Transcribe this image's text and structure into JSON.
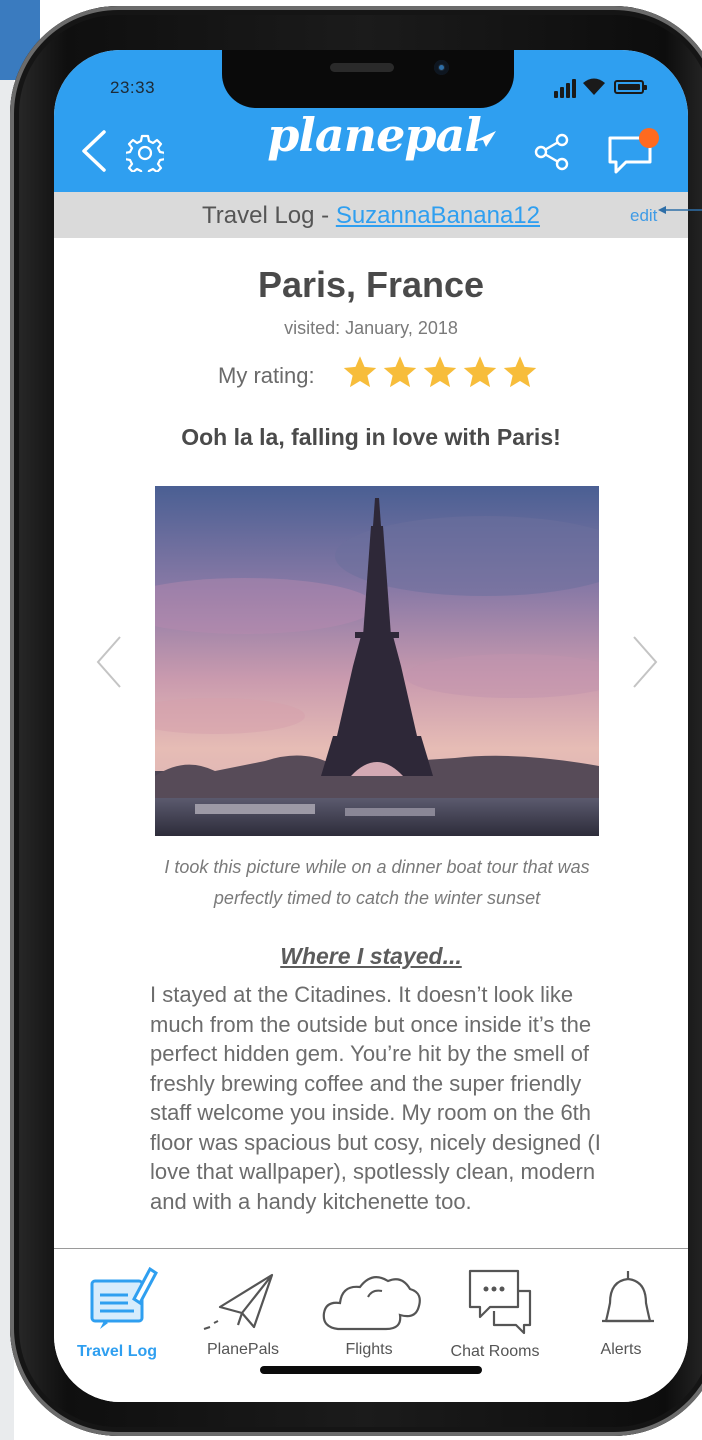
{
  "status": {
    "time": "23:33"
  },
  "app": {
    "logo": "planepal"
  },
  "subheader": {
    "prefix": "Travel Log - ",
    "username": "SuzannaBanana12",
    "edit": "edit"
  },
  "entry": {
    "place": "Paris, France",
    "visited": "visited: January, 2018",
    "rating_label": "My rating:",
    "rating": 5,
    "rating_max": 5,
    "headline": "Ooh la la, falling in love with Paris!",
    "caption": "I took this picture while on a dinner boat tour that was perfectly timed to catch the winter sunset",
    "section_title": "Where I stayed...",
    "body": "I stayed at the Citadines.  It doesn’t look like much from the outside but once inside it’s the perfect hidden gem. You’re hit by the smell of freshly brewing coffee and the super friendly staff welcome you inside. My room on the 6th floor was spacious but cosy, nicely designed (I love that wallpaper), spotlessly clean, modern and with a handy kitchenette too."
  },
  "tabs": [
    {
      "label": "Travel Log",
      "icon": "travel-log-icon",
      "active": true
    },
    {
      "label": "PlanePals",
      "icon": "paper-plane-icon",
      "active": false
    },
    {
      "label": "Flights",
      "icon": "cloud-icon",
      "active": false
    },
    {
      "label": "Chat Rooms",
      "icon": "chat-bubbles-icon",
      "active": false
    },
    {
      "label": "Alerts",
      "icon": "bell-icon",
      "active": false
    }
  ],
  "colors": {
    "primary": "#2f9ff0",
    "star": "#f7bd3b",
    "notification": "#ff6a1f",
    "subbar": "#dadada"
  }
}
